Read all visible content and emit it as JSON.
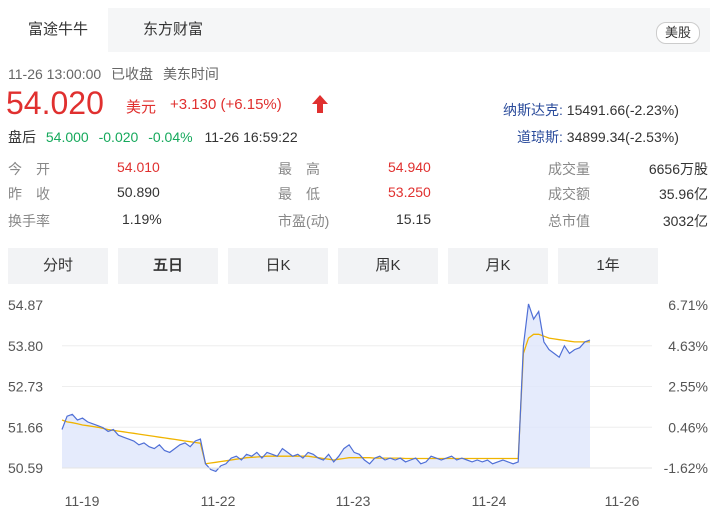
{
  "tabs": {
    "active": "富途牛牛",
    "second": "东方财富",
    "market": "美股"
  },
  "status": {
    "time": "11-26 13:00:00",
    "state": "已收盘",
    "tz": "美东时间"
  },
  "price": {
    "value": "54.020",
    "currency": "美元",
    "change": "+3.130 (+6.15%)",
    "arrow": "▲"
  },
  "after_hours": {
    "label": "盘后",
    "price": "54.000",
    "change": "-0.020",
    "pct": "-0.04%",
    "time": "11-26 16:59:22"
  },
  "indices": [
    {
      "name": "纳斯达克:",
      "value": "15491.66(-2.23%)"
    },
    {
      "name": "道琼斯:",
      "value": "34899.34(-2.53%)"
    }
  ],
  "stats": [
    [
      {
        "label": "今　开",
        "value": "54.010",
        "color": "red"
      },
      {
        "label": "最　高",
        "value": "54.940",
        "color": "red"
      },
      {
        "label": "成交量",
        "value": "6656万股",
        "color": "dark"
      }
    ],
    [
      {
        "label": "昨　收",
        "value": "50.890",
        "color": "dark"
      },
      {
        "label": "最　低",
        "value": "53.250",
        "color": "red"
      },
      {
        "label": "成交额",
        "value": "35.96亿",
        "color": "dark"
      }
    ],
    [
      {
        "label": "换手率",
        "value": "1.19%",
        "color": "dark"
      },
      {
        "label": "市盈(动)",
        "value": "15.15",
        "color": "dark"
      },
      {
        "label": "总市值",
        "value": "3032亿",
        "color": "dark"
      }
    ]
  ],
  "periods": [
    "分时",
    "五日",
    "日K",
    "周K",
    "月K",
    "1年"
  ],
  "active_period": "五日",
  "chart_data": {
    "type": "line",
    "y_left_ticks": [
      "54.87",
      "53.80",
      "52.73",
      "51.66",
      "50.59"
    ],
    "y_right_ticks": [
      "6.71%",
      "4.63%",
      "2.55%",
      "0.46%",
      "-1.62%"
    ],
    "x_ticks": [
      "11-19",
      "11-22",
      "11-23",
      "11-24",
      "11-26"
    ],
    "ylim": [
      50.59,
      54.87
    ],
    "colors": {
      "price": "#4f6fd6",
      "avg": "#f0b400",
      "fill": "#dfe6fb"
    },
    "series": [
      {
        "role": "price",
        "values": [
          51.6,
          51.95,
          52.0,
          51.85,
          51.9,
          51.8,
          51.75,
          51.7,
          51.65,
          51.55,
          51.6,
          51.45,
          51.4,
          51.35,
          51.3,
          51.2,
          51.25,
          51.15,
          51.1,
          51.2,
          51.05,
          51.0,
          51.1,
          51.2,
          51.25,
          51.15,
          51.3,
          51.35,
          50.7,
          50.55,
          50.5,
          50.65,
          50.7,
          50.85,
          50.9,
          50.8,
          50.95,
          50.9,
          51.0,
          50.85,
          51.0,
          50.95,
          50.9,
          51.1,
          51.0,
          50.9,
          50.95,
          50.85,
          51.0,
          50.95,
          50.85,
          50.8,
          50.95,
          50.75,
          50.9,
          51.1,
          51.2,
          51.0,
          50.95,
          50.8,
          50.7,
          50.85,
          50.9,
          50.8,
          50.85,
          50.8,
          50.85,
          50.75,
          50.8,
          50.85,
          50.7,
          50.75,
          50.9,
          50.85,
          50.8,
          50.85,
          50.9,
          50.8,
          50.85,
          50.8,
          50.75,
          50.8,
          50.75,
          50.8,
          50.7,
          50.75,
          50.8,
          50.75,
          50.7,
          50.75,
          53.8,
          54.9,
          54.5,
          54.7,
          53.9,
          53.7,
          53.6,
          53.5,
          53.8,
          53.6,
          53.7,
          53.75,
          53.9,
          53.95
        ],
        "dates": []
      },
      {
        "role": "avg",
        "values": [
          51.85,
          51.8,
          51.78,
          51.75,
          51.72,
          51.7,
          51.68,
          51.66,
          51.63,
          51.6,
          51.58,
          51.56,
          51.54,
          51.52,
          51.5,
          51.48,
          51.46,
          51.44,
          51.42,
          51.4,
          51.38,
          51.36,
          51.34,
          51.32,
          51.3,
          51.28,
          51.26,
          51.24,
          50.7,
          50.72,
          50.74,
          50.76,
          50.78,
          50.8,
          50.82,
          50.84,
          50.86,
          50.87,
          50.88,
          50.89,
          50.9,
          50.9,
          50.9,
          50.9,
          50.9,
          50.9,
          50.9,
          50.9,
          50.9,
          50.88,
          50.86,
          50.84,
          50.82,
          50.8,
          50.82,
          50.84,
          50.86,
          50.86,
          50.86,
          50.86,
          50.86,
          50.85,
          50.85,
          50.85,
          50.85,
          50.85,
          50.85,
          50.84,
          50.84,
          50.84,
          50.84,
          50.84,
          50.84,
          50.84,
          50.84,
          50.84,
          50.84,
          50.84,
          50.84,
          50.84,
          50.84,
          50.84,
          50.84,
          50.84,
          50.84,
          50.84,
          50.84,
          50.84,
          50.84,
          50.84,
          53.6,
          54.0,
          54.1,
          54.1,
          54.05,
          54.0,
          53.98,
          53.96,
          53.94,
          53.92,
          53.9,
          53.9,
          53.9,
          53.9
        ]
      }
    ]
  }
}
